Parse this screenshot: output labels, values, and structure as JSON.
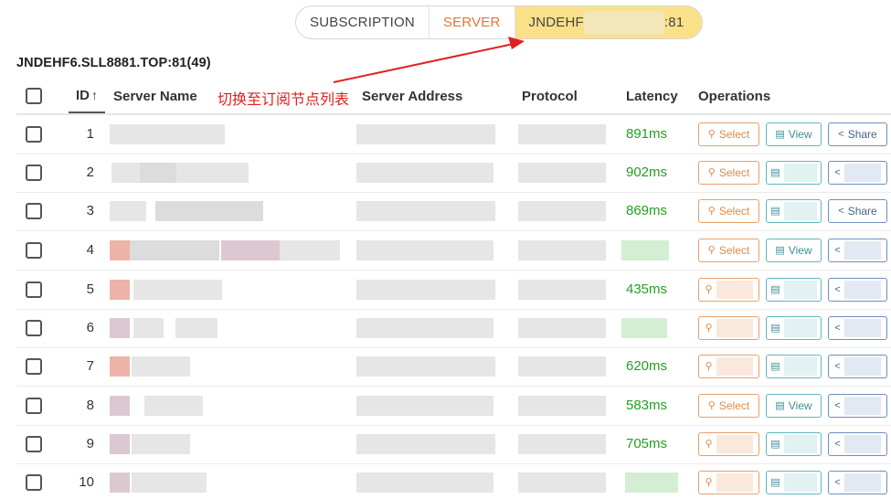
{
  "tabs": [
    {
      "label": "SUBSCRIPTION"
    },
    {
      "label": "SERVER"
    },
    {
      "label_prefix": "JNDEHF",
      "label_suffix": ":81"
    }
  ],
  "subscription_title": "JNDEHF6.SLL8881.TOP:81(49)",
  "table": {
    "headers": {
      "id": "ID",
      "sort": "↑",
      "name": "Server Name",
      "address": "Server Address",
      "protocol": "Protocol",
      "latency": "Latency",
      "operations": "Operations"
    },
    "rows": [
      {
        "id": "1",
        "latency": "891ms",
        "select": "Select",
        "view": "View",
        "share": "Share"
      },
      {
        "id": "2",
        "latency": "902ms",
        "select": "Select",
        "view": "",
        "share": ""
      },
      {
        "id": "3",
        "latency": "869ms",
        "select": "Select",
        "view": "",
        "share": "Share"
      },
      {
        "id": "4",
        "latency": "",
        "select": "Select",
        "view": "View",
        "share": ""
      },
      {
        "id": "5",
        "latency": "435ms",
        "select": "",
        "view": "",
        "share": ""
      },
      {
        "id": "6",
        "latency": "",
        "select": "",
        "view": "",
        "share": ""
      },
      {
        "id": "7",
        "latency": "620ms",
        "select": "",
        "view": "",
        "share": ""
      },
      {
        "id": "8",
        "latency": "583ms",
        "select": "Select",
        "view": "View",
        "share": ""
      },
      {
        "id": "9",
        "latency": "705ms",
        "select": "",
        "view": "",
        "share": ""
      },
      {
        "id": "10",
        "latency": "",
        "select": "",
        "view": "",
        "share": ""
      }
    ]
  },
  "annotation": "切换至订阅节点列表",
  "colors": {
    "accent_tab": "#fbe08a",
    "server_tab": "#e8753a",
    "latency": "#22a022",
    "annotation": "#e02020",
    "select_btn": "#e8a06a",
    "view_btn": "#5fb7c0",
    "share_btn": "#6f8fbf"
  },
  "icons": {
    "select": "link-icon",
    "view": "document-icon",
    "share": "share-icon"
  }
}
